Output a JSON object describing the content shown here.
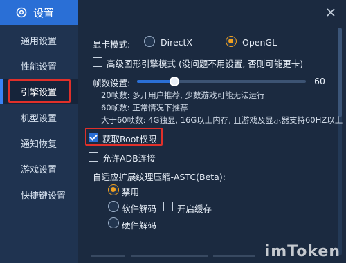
{
  "header": {
    "title": "设置",
    "icon": "gear-icon"
  },
  "sidebar": {
    "items": [
      {
        "label": "通用设置",
        "active": false
      },
      {
        "label": "性能设置",
        "active": false
      },
      {
        "label": "引擎设置",
        "active": true
      },
      {
        "label": "机型设置",
        "active": false
      },
      {
        "label": "通知恢复",
        "active": false
      },
      {
        "label": "游戏设置",
        "active": false
      },
      {
        "label": "快捷键设置",
        "active": false
      }
    ]
  },
  "graphics": {
    "label": "显卡模式:",
    "options": [
      {
        "label": "DirectX",
        "selected": false
      },
      {
        "label": "OpenGL",
        "selected": true
      }
    ]
  },
  "advanced_graphics": {
    "label": "高级图形引擎模式 (没问题不用设置, 否则可能更卡)",
    "checked": false
  },
  "fps": {
    "label": "帧数设置:",
    "value": "60",
    "fraction": 0.22,
    "notes": [
      "20帧数: 多开用户推荐, 少数游戏可能无法运行",
      "60帧数: 正常情况下推荐",
      "大于60帧数: 4G独显, 16G以上内存, 且游戏及显示器支持60HZ以上"
    ]
  },
  "root": {
    "label": "获取Root权限",
    "checked": true
  },
  "adb": {
    "label": "允许ADB连接",
    "checked": false
  },
  "astc": {
    "label": "自适应扩展纹理压缩-ASTC(Beta):",
    "options": [
      {
        "label": "禁用",
        "selected": true
      },
      {
        "label": "软件解码",
        "selected": false
      },
      {
        "label": "硬件解码",
        "selected": false
      }
    ],
    "cache": {
      "label": "开启缓存",
      "checked": false
    }
  },
  "watermark": "imToken",
  "colors": {
    "accent": "#2a6fd6",
    "radio_on": "#f0a020",
    "highlight": "#e0302a"
  }
}
